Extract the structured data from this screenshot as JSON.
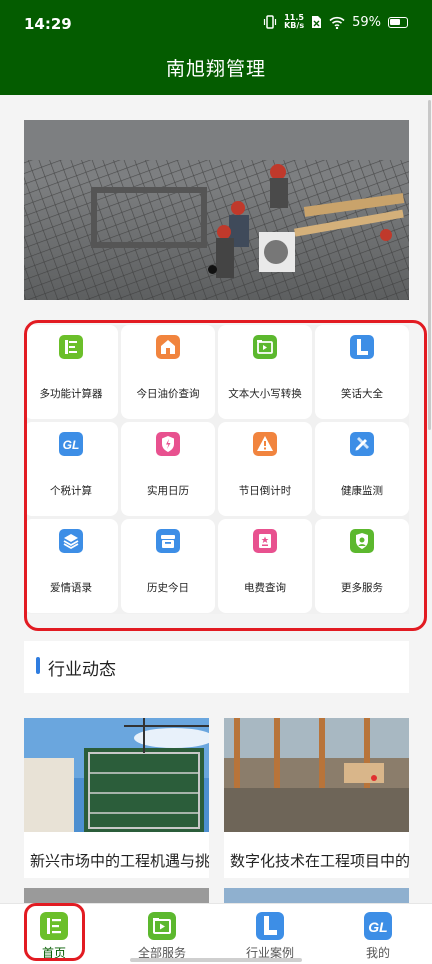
{
  "status": {
    "time": "14:29",
    "speed_value": "11.5",
    "speed_unit": "KB/s",
    "battery": "59%"
  },
  "header": {
    "title": "南旭翔管理"
  },
  "banner": {
    "active_slide": 1,
    "slide_count": 1
  },
  "services": [
    {
      "label": "多功能计算器",
      "icon": "calculator-icon",
      "color": "#6bbf2a"
    },
    {
      "label": "今日油价查询",
      "icon": "house-icon",
      "color": "#f1843e"
    },
    {
      "label": "文本大小写转换",
      "icon": "text-convert-icon",
      "color": "#5cb82e"
    },
    {
      "label": "笑话大全",
      "icon": "letter-l-icon",
      "color": "#3d8ee6"
    },
    {
      "label": "个税计算",
      "icon": "gl-icon",
      "color": "#3d8ee6"
    },
    {
      "label": "实用日历",
      "icon": "shield-bolt-icon",
      "color": "#e8518f"
    },
    {
      "label": "节日倒计时",
      "icon": "warning-triangle-icon",
      "color": "#f1843e"
    },
    {
      "label": "健康监测",
      "icon": "pencil-ruler-icon",
      "color": "#3d8ee6"
    },
    {
      "label": "爱情语录",
      "icon": "layers-icon",
      "color": "#3d8ee6"
    },
    {
      "label": "历史今日",
      "icon": "archive-box-icon",
      "color": "#3d8ee6"
    },
    {
      "label": "电费查询",
      "icon": "star-document-icon",
      "color": "#e8518f"
    },
    {
      "label": "更多服务",
      "icon": "badge-icon",
      "color": "#5cb82e"
    }
  ],
  "industry": {
    "heading": "行业动态"
  },
  "news": [
    {
      "title": "新兴市场中的工程机遇与挑战"
    },
    {
      "title": "数字化技术在工程项目中的应用"
    }
  ],
  "tabs": [
    {
      "label": "首页",
      "icon": "list-doc-icon",
      "color": "#6bbf2a",
      "active": true
    },
    {
      "label": "全部服务",
      "icon": "media-icon",
      "color": "#5cb82e",
      "active": false
    },
    {
      "label": "行业案例",
      "icon": "letter-l-icon",
      "color": "#3d8ee6",
      "active": false
    },
    {
      "label": "我的",
      "icon": "gl-icon",
      "color": "#3d8ee6",
      "active": false
    }
  ]
}
